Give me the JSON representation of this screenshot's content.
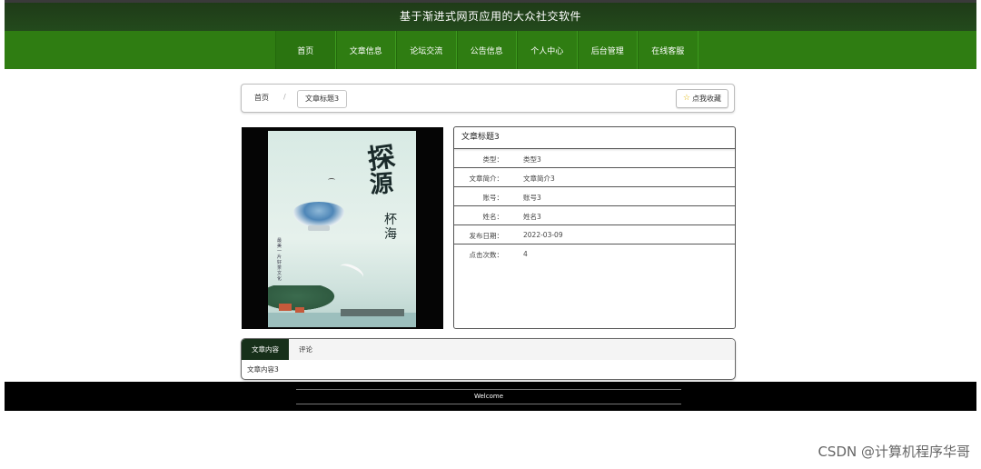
{
  "header": {
    "title": "基于渐进式网页应用的大众社交软件"
  },
  "nav": {
    "items": [
      {
        "label": "首页"
      },
      {
        "label": "文章信息"
      },
      {
        "label": "论坛交流"
      },
      {
        "label": "公告信息"
      },
      {
        "label": "个人中心"
      },
      {
        "label": "后台管理"
      },
      {
        "label": "在线客服"
      }
    ]
  },
  "breadcrumb": {
    "home": "首页",
    "separator": "/",
    "current": "文章标题3"
  },
  "favorite": {
    "label": "点我收藏",
    "icon": "star-icon"
  },
  "cover": {
    "calligraphy_1": "探",
    "calligraphy_2": "源",
    "subtitle_1": "杯",
    "subtitle_2": "海",
    "vertical_text": "最美一片好茶文化"
  },
  "detail": {
    "title": "文章标题3",
    "rows": [
      {
        "label": "类型：",
        "value": "类型3"
      },
      {
        "label": "文章简介：",
        "value": "文章简介3"
      },
      {
        "label": "账号：",
        "value": "账号3"
      },
      {
        "label": "姓名：",
        "value": "姓名3"
      },
      {
        "label": "发布日期：",
        "value": "2022-03-09"
      },
      {
        "label": "点击次数：",
        "value": "4"
      }
    ]
  },
  "tabs": {
    "items": [
      {
        "label": "文章内容"
      },
      {
        "label": "评论"
      }
    ],
    "content": "文章内容3"
  },
  "footer": {
    "welcome": "Welcome"
  },
  "watermark": "CSDN @计算机程序华哥",
  "colors": {
    "nav_green": "#2f7d12",
    "header_dark_green": "#234a1c",
    "tab_active": "#17301a",
    "footer": "#000000"
  }
}
